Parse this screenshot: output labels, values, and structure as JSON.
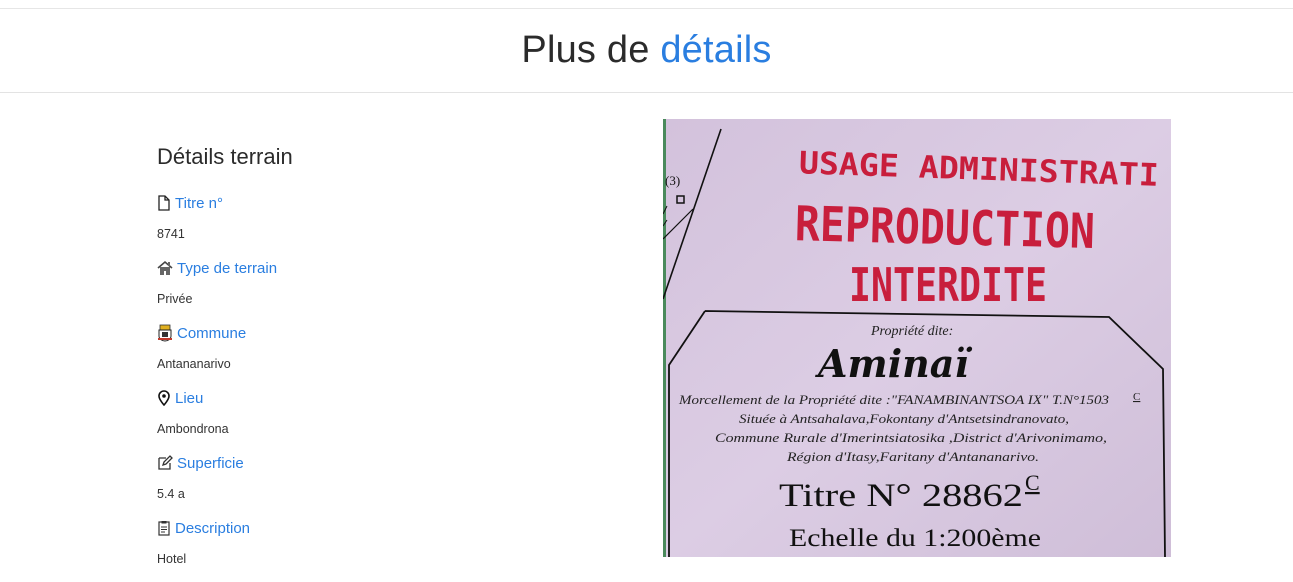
{
  "header": {
    "title_main": "Plus de",
    "title_accent": "détails"
  },
  "details": {
    "heading": "Détails terrain",
    "fields": [
      {
        "label": "Titre n°",
        "value": "8741",
        "icon": "document-icon"
      },
      {
        "label": "Type de terrain",
        "value": "Privée",
        "icon": "house-icon"
      },
      {
        "label": "Commune",
        "value": "Antananarivo",
        "icon": "coat-of-arms-icon"
      },
      {
        "label": "Lieu",
        "value": "Ambondrona",
        "icon": "location-pin-icon"
      },
      {
        "label": "Superficie",
        "value": "5.4 a",
        "icon": "edit-icon"
      },
      {
        "label": "Description",
        "value": "Hotel",
        "icon": "clipboard-icon"
      }
    ]
  },
  "document": {
    "stamp_line1": "USAGE ADMINISTRATI",
    "stamp_line2": "REPRODUCTION",
    "stamp_line3": "INTERDITE",
    "label_propriete": "Propriété dite:",
    "property_name": "Aminaï",
    "morcellement": "Morcellement de la Propriété dite :\"FANAMBINANTSOA IX\" T.N°1503",
    "morcellement_sup": "C",
    "situee": "Située à Antsahalava,Fokontany d'Antsetsindranovato,",
    "commune_line": "Commune Rurale d'Imerintsiatosika ,District d'Arivonimamo,",
    "region_line": "Région d'Itasy,Faritany d'Antananarivo.",
    "titre": "Titre N° 28862",
    "titre_sup": "C",
    "echelle": "Echelle du 1:200ème",
    "plot_label": "(3)"
  },
  "colors": {
    "accent": "#2a7ee0",
    "stamp": "#c81e3c",
    "paper": "#d6c6de"
  }
}
